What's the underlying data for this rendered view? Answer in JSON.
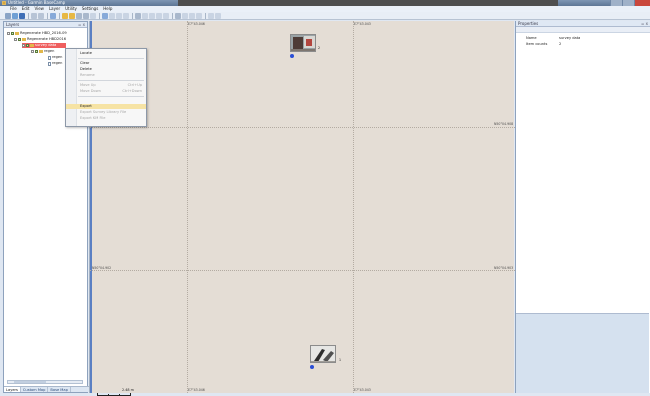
{
  "window": {
    "title": "Untitled - Garmin BaseCamp"
  },
  "menubar": {
    "items": [
      "File",
      "Edit",
      "View",
      "Layer",
      "Utility",
      "Settings",
      "Help"
    ]
  },
  "layers_panel": {
    "title": "Layers",
    "header_buttons": "= x",
    "tree": [
      {
        "label": "Regenerate HBD_2016-09",
        "level": 0
      },
      {
        "label": "Regenerate HBD2016",
        "level": 1
      },
      {
        "label": "survey data",
        "level": 2,
        "selected": true
      },
      {
        "label": "regen",
        "level": 2
      },
      {
        "label": "regen",
        "level": 3
      },
      {
        "label": "regen",
        "level": 3
      }
    ],
    "tabs": [
      "Layers",
      "Custom Map",
      "Base Map"
    ]
  },
  "context_menu": {
    "items": [
      {
        "label": "Locate",
        "shortcut": "",
        "enabled": true
      },
      {
        "label": "Clear",
        "shortcut": "",
        "enabled": true
      },
      {
        "label": "Delete",
        "shortcut": "",
        "enabled": true
      },
      {
        "label": "Rename",
        "shortcut": "",
        "enabled": false
      },
      {
        "label": "Move Up",
        "shortcut": "Ctrl+Up",
        "enabled": false
      },
      {
        "label": "Move Down",
        "shortcut": "Ctrl+Down",
        "enabled": false
      },
      {
        "label": "Export",
        "shortcut": "",
        "enabled": true,
        "highlighted": true
      },
      {
        "label": "Export Survey Library File",
        "shortcut": "",
        "enabled": false
      },
      {
        "label": "Export KM File",
        "shortcut": "",
        "enabled": false
      }
    ]
  },
  "map": {
    "grid_labels": {
      "top_left": "E7°43.046",
      "top_right": "E7°43.043",
      "bottom_left": "E7°43.046",
      "bottom_right": "E7°43.043",
      "right_upper": "N50°04.908",
      "left_lower": "N50°04.902",
      "right_lower": "N50°04.903"
    },
    "markers": [
      {
        "label": "2"
      },
      {
        "label": "1"
      }
    ],
    "scale": "2.48 m"
  },
  "properties_panel": {
    "title": "Properties",
    "header_buttons": "= x",
    "rows": [
      {
        "name": "Name",
        "value": "survey data"
      },
      {
        "name": "Item counts",
        "value": "2"
      }
    ]
  }
}
